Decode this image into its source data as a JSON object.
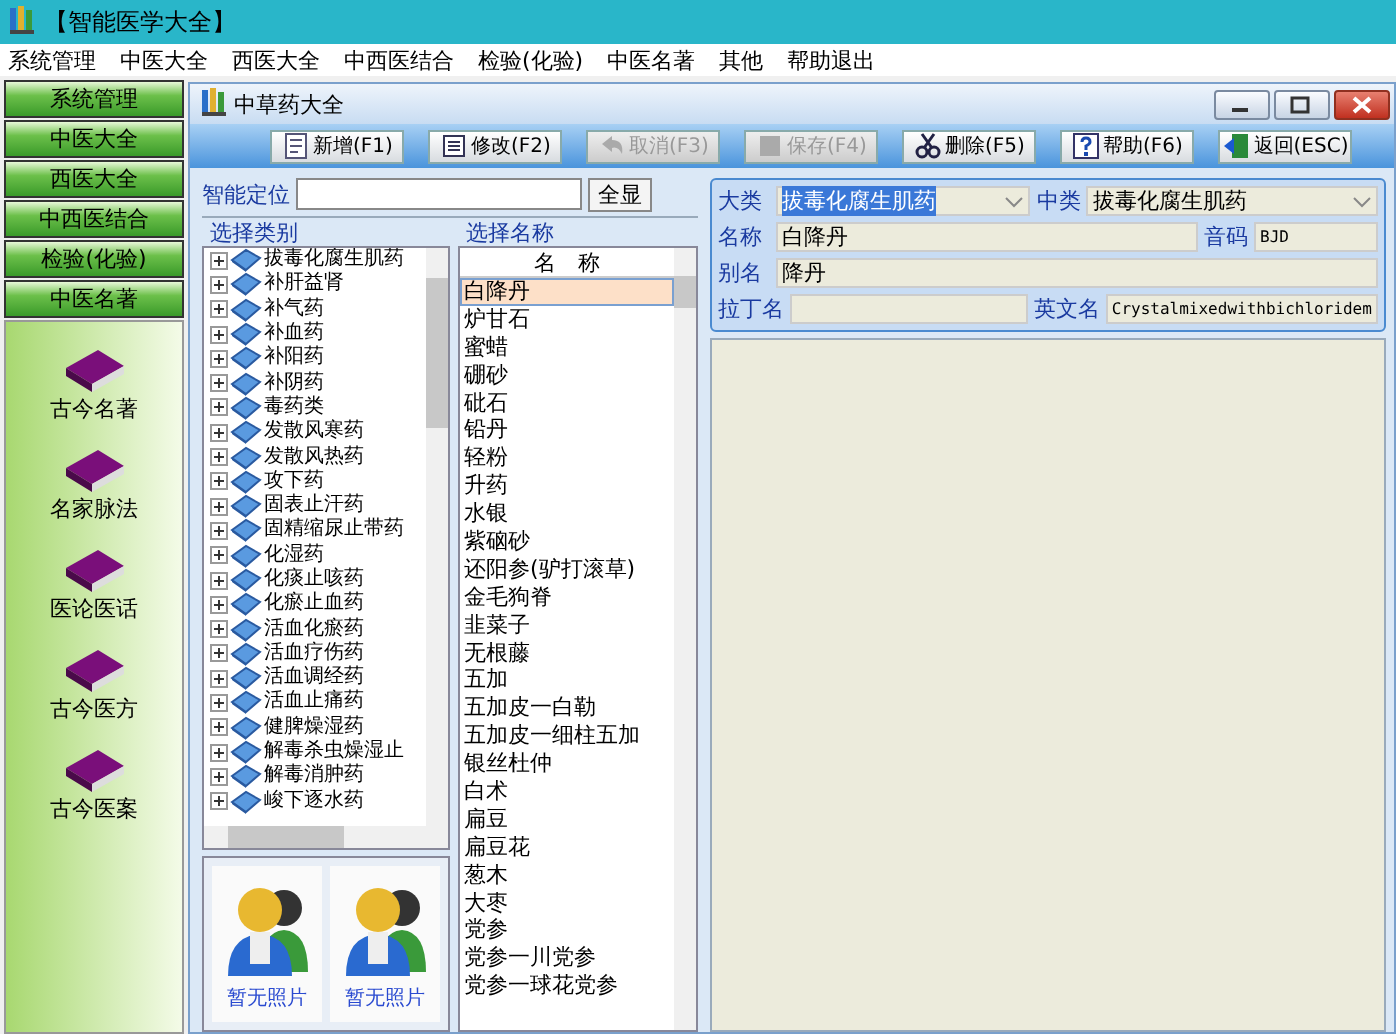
{
  "app": {
    "title": "【智能医学大全】"
  },
  "menu": [
    "系统管理",
    "中医大全",
    "西医大全",
    "中西医结合",
    "检验(化验)",
    "中医名著",
    "其他",
    "帮助退出"
  ],
  "sidebar": {
    "buttons": [
      "系统管理",
      "中医大全",
      "西医大全",
      "中西医结合",
      "检验(化验)",
      "中医名著"
    ],
    "items": [
      "古今名著",
      "名家脉法",
      "医论医话",
      "古今医方",
      "古今医案"
    ]
  },
  "window": {
    "title": "中草药大全"
  },
  "toolbar": [
    {
      "label": "新增(F1)",
      "kind": "new",
      "disabled": false
    },
    {
      "label": "修改(F2)",
      "kind": "edit",
      "disabled": false
    },
    {
      "label": "取消(F3)",
      "kind": "undo",
      "disabled": true
    },
    {
      "label": "保存(F4)",
      "kind": "save",
      "disabled": true
    },
    {
      "label": "删除(F5)",
      "kind": "cut",
      "disabled": false
    },
    {
      "label": "帮助(F6)",
      "kind": "help",
      "disabled": false
    },
    {
      "label": "返回(ESC)",
      "kind": "exit",
      "disabled": false
    }
  ],
  "locate": {
    "label": "智能定位",
    "button": "全显"
  },
  "categories": {
    "title": "选择类别",
    "items": [
      "拔毒化腐生肌药",
      "补肝益肾",
      "补气药",
      "补血药",
      "补阳药",
      "补阴药",
      "毒药类",
      "发散风寒药",
      "发散风热药",
      "攻下药",
      "固表止汗药",
      "固精缩尿止带药",
      "化湿药",
      "化痰止咳药",
      "化瘀止血药",
      "活血化瘀药",
      "活血疗伤药",
      "活血调经药",
      "活血止痛药",
      "健脾燥湿药",
      "解毒杀虫燥湿止",
      "解毒消肿药",
      "峻下逐水药"
    ]
  },
  "photos": [
    {
      "caption": "暂无照片"
    },
    {
      "caption": "暂无照片"
    }
  ],
  "names": {
    "title": "选择名称",
    "header": "名　称",
    "items": [
      {
        "label": "白降丹",
        "selected": true
      },
      {
        "label": "炉甘石",
        "selected": false
      },
      {
        "label": "蜜蜡",
        "selected": false
      },
      {
        "label": "硼砂",
        "selected": false
      },
      {
        "label": "砒石",
        "selected": false
      },
      {
        "label": "铅丹",
        "selected": false
      },
      {
        "label": "轻粉",
        "selected": false
      },
      {
        "label": "升药",
        "selected": false
      },
      {
        "label": "水银",
        "selected": false
      },
      {
        "label": "紫硇砂",
        "selected": false
      },
      {
        "label": "还阳参(驴打滚草)",
        "selected": false
      },
      {
        "label": "金毛狗脊",
        "selected": false
      },
      {
        "label": "韭菜子",
        "selected": false
      },
      {
        "label": "无根藤",
        "selected": false
      },
      {
        "label": "五加",
        "selected": false
      },
      {
        "label": "五加皮一白勒",
        "selected": false
      },
      {
        "label": "五加皮一细柱五加",
        "selected": false
      },
      {
        "label": "银丝杜仲",
        "selected": false
      },
      {
        "label": "白术",
        "selected": false
      },
      {
        "label": "扁豆",
        "selected": false
      },
      {
        "label": "扁豆花",
        "selected": false
      },
      {
        "label": "葱木",
        "selected": false
      },
      {
        "label": "大枣",
        "selected": false
      },
      {
        "label": "党参",
        "selected": false
      },
      {
        "label": "党参一川党参",
        "selected": false
      },
      {
        "label": "党参一球花党参",
        "selected": false
      }
    ]
  },
  "form": {
    "rows": [
      [
        {
          "label": "大类",
          "kind": "select",
          "value": "拔毒化腐生肌药",
          "highlighted": true
        },
        {
          "label": "中类",
          "kind": "select",
          "value": "拔毒化腐生肌药"
        }
      ],
      [
        {
          "label": "名称",
          "kind": "text",
          "value": "白降丹"
        },
        {
          "label": "音码",
          "kind": "code",
          "value": "BJD"
        }
      ],
      [
        {
          "label": "别名",
          "kind": "text",
          "value": "降丹"
        }
      ],
      [
        {
          "label": "拉丁名",
          "kind": "text"
        },
        {
          "label": "英文名",
          "kind": "code",
          "value": "Crystalmixedwithbichloridem"
        }
      ]
    ]
  }
}
